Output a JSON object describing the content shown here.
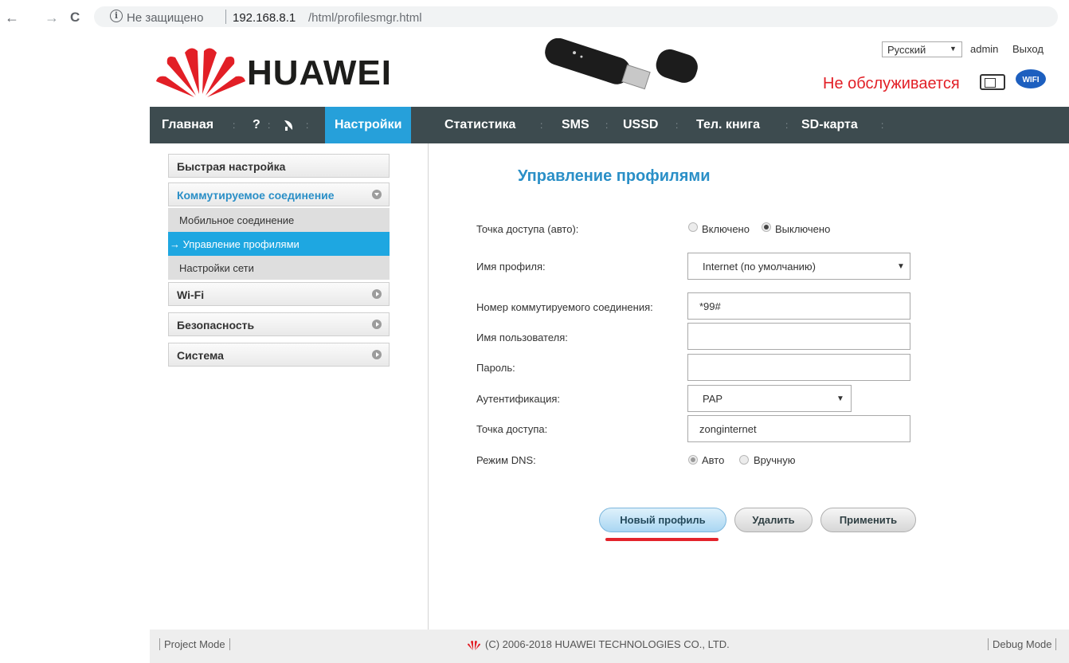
{
  "browser": {
    "back_icon": "←",
    "forward_icon": "→",
    "reload_icon": "C",
    "info_icon": "i",
    "security_label": "Не защищено",
    "url_host": "192.168.8.1",
    "url_path": "/html/profilesmgr.html"
  },
  "header": {
    "logo_text": "HUAWEI",
    "language": "Русский",
    "language_arrow": "▼",
    "user": "admin",
    "logout": "Выход",
    "status": "Не обслуживается",
    "wifi_badge": "WIFI",
    "brand_color": "#e21f26"
  },
  "menu": {
    "home": "Главная",
    "help": "?",
    "settings": "Настройки",
    "statistics": "Статистика",
    "sms": "SMS",
    "ussd": "USSD",
    "phonebook": "Тел. книга",
    "sdcard": "SD-карта",
    "separator": ":",
    "accent_color": "#26a0da"
  },
  "sidebar": {
    "quick_setup": "Быстрая настройка",
    "dialup": "Коммутируемое соединение",
    "mobile_connection": "Мобильное соединение",
    "profile_management": "→ Управление профилями",
    "network_settings": "Настройки сети",
    "wifi": "Wi-Fi",
    "security": "Безопасность",
    "system": "Система"
  },
  "content": {
    "title": "Управление профилями",
    "apn_auto_label": "Точка доступа (авто):",
    "apn_auto_on": "Включено",
    "apn_auto_off": "Выключено",
    "profile_name_label": "Имя профиля:",
    "profile_name_value": "Internet (по умолчанию)",
    "dial_number_label": "Номер коммутируемого соединения:",
    "dial_number_value": "*99#",
    "username_label": "Имя пользователя:",
    "username_value": "",
    "password_label": "Пароль:",
    "password_value": "",
    "auth_label": "Аутентификация:",
    "auth_value": "PAP",
    "apn_label": "Точка доступа:",
    "apn_value": "zonginternet",
    "dns_label": "Режим DNS:",
    "dns_auto": "Авто",
    "dns_manual": "Вручную",
    "select_arrow": "▼"
  },
  "buttons": {
    "new_profile": "Новый профиль",
    "delete": "Удалить",
    "apply": "Применить"
  },
  "footer": {
    "project_mode": "Project Mode",
    "copyright": "(C) 2006-2018 HUAWEI TECHNOLOGIES CO., LTD.",
    "debug_mode": "Debug Mode"
  }
}
